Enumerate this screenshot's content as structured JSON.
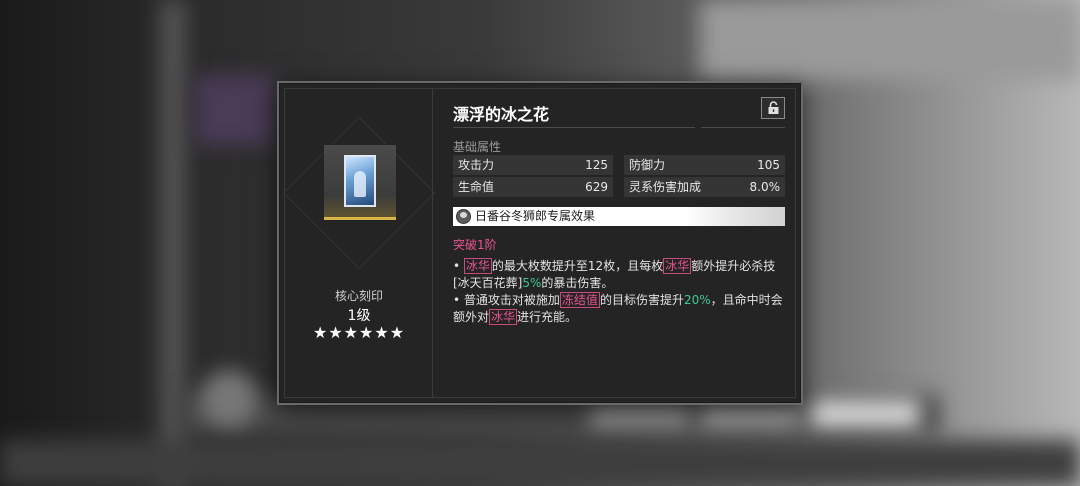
{
  "panel": {
    "title": "漂浮的冰之花",
    "lock_icon": "lock-open-icon",
    "left": {
      "core_label": "核心刻印",
      "level": "1级",
      "stars": "★★★★★★",
      "star_count": 6
    },
    "basic_attr_label": "基础属性",
    "stats": [
      {
        "name": "攻击力",
        "value": "125"
      },
      {
        "name": "防御力",
        "value": "105"
      },
      {
        "name": "生命值",
        "value": "629"
      },
      {
        "name": "灵系伤害加成",
        "value": "8.0%"
      }
    ],
    "exclusive": "日番谷冬狮郎专属效果",
    "breakthrough": "突破1阶",
    "effect1": {
      "bullet": "•",
      "tag1": "冰华",
      "t1": "的最大枚数提升至12枚，且每枚",
      "tag2": "冰华",
      "t2": "额外提升必杀技[冰天百花葬]",
      "pct": "5%",
      "t3": "的暴击伤害。"
    },
    "effect2": {
      "bullet": "•",
      "t1": "普通攻击对被施加",
      "tag1": "冻结值",
      "t2": "的目标伤害提升",
      "pct": "20%",
      "t3": "，且命中时会额外对",
      "tag2": "冰华",
      "t4": "进行充能。"
    }
  },
  "colors": {
    "accent_pink": "#e8558e",
    "accent_green": "#3ec98f",
    "card_gold": "#d9b446"
  }
}
